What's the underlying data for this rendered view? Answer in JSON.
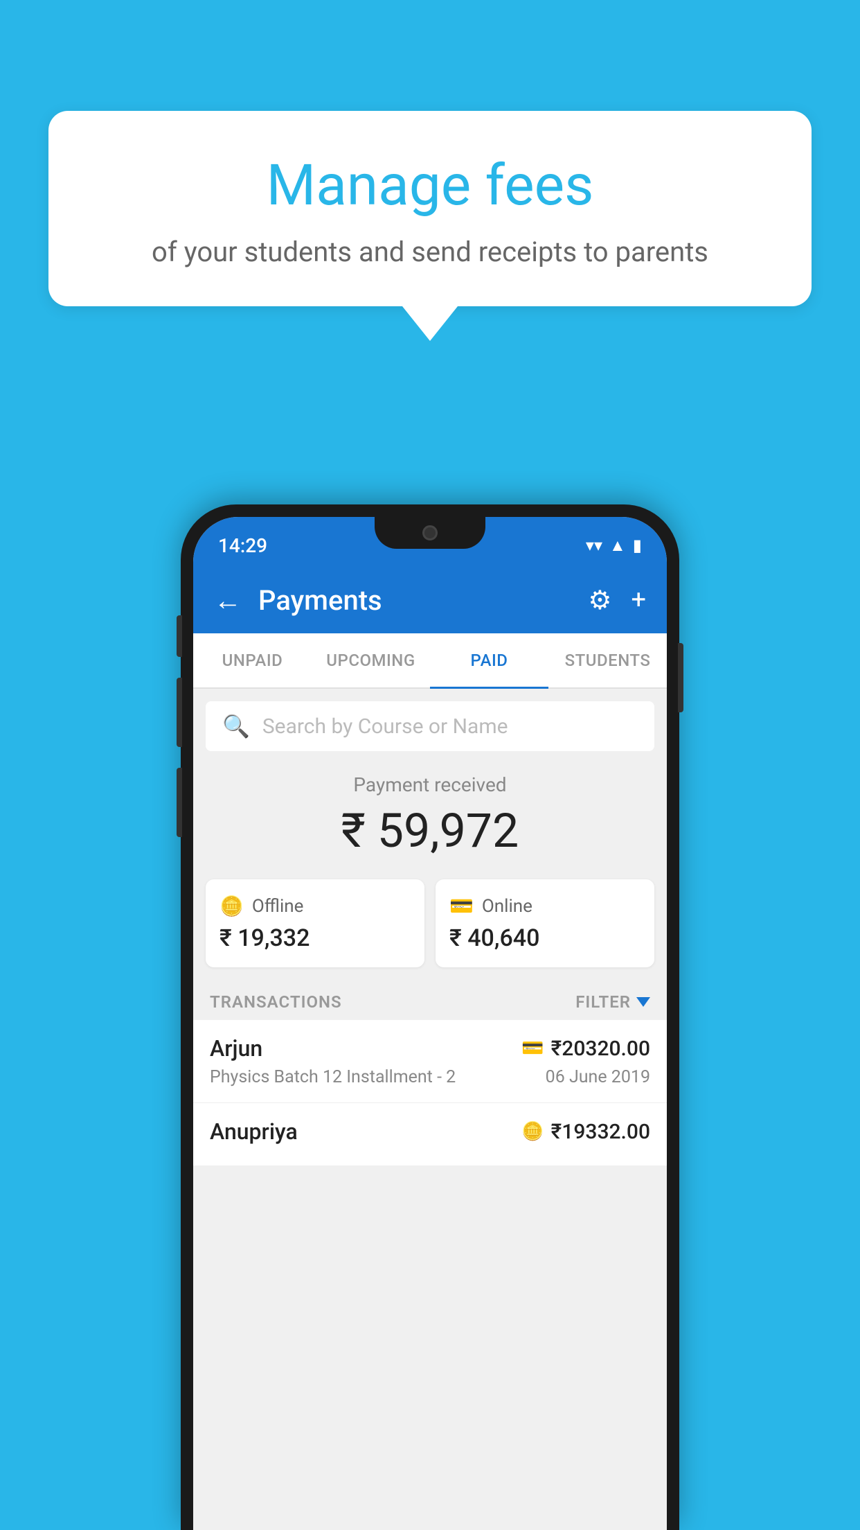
{
  "background_color": "#29b6e8",
  "speech_bubble": {
    "title": "Manage fees",
    "subtitle": "of your students and send receipts to parents"
  },
  "status_bar": {
    "time": "14:29",
    "wifi_icon": "▼",
    "signal_icon": "▲",
    "battery_icon": "▮"
  },
  "header": {
    "title": "Payments",
    "back_label": "←",
    "settings_label": "⚙",
    "add_label": "+"
  },
  "tabs": [
    {
      "id": "unpaid",
      "label": "UNPAID",
      "active": false
    },
    {
      "id": "upcoming",
      "label": "UPCOMING",
      "active": false
    },
    {
      "id": "paid",
      "label": "PAID",
      "active": true
    },
    {
      "id": "students",
      "label": "STUDENTS",
      "active": false
    }
  ],
  "search": {
    "placeholder": "Search by Course or Name"
  },
  "payment_summary": {
    "label": "Payment received",
    "amount": "₹ 59,972"
  },
  "payment_cards": [
    {
      "id": "offline",
      "icon": "offline",
      "label": "Offline",
      "amount": "₹ 19,332"
    },
    {
      "id": "online",
      "icon": "online",
      "label": "Online",
      "amount": "₹ 40,640"
    }
  ],
  "transactions": {
    "header_label": "TRANSACTIONS",
    "filter_label": "FILTER",
    "items": [
      {
        "name": "Arjun",
        "payment_type": "online",
        "amount": "₹20320.00",
        "detail": "Physics Batch 12 Installment - 2",
        "date": "06 June 2019"
      },
      {
        "name": "Anupriya",
        "payment_type": "offline",
        "amount": "₹19332.00",
        "detail": "",
        "date": ""
      }
    ]
  }
}
